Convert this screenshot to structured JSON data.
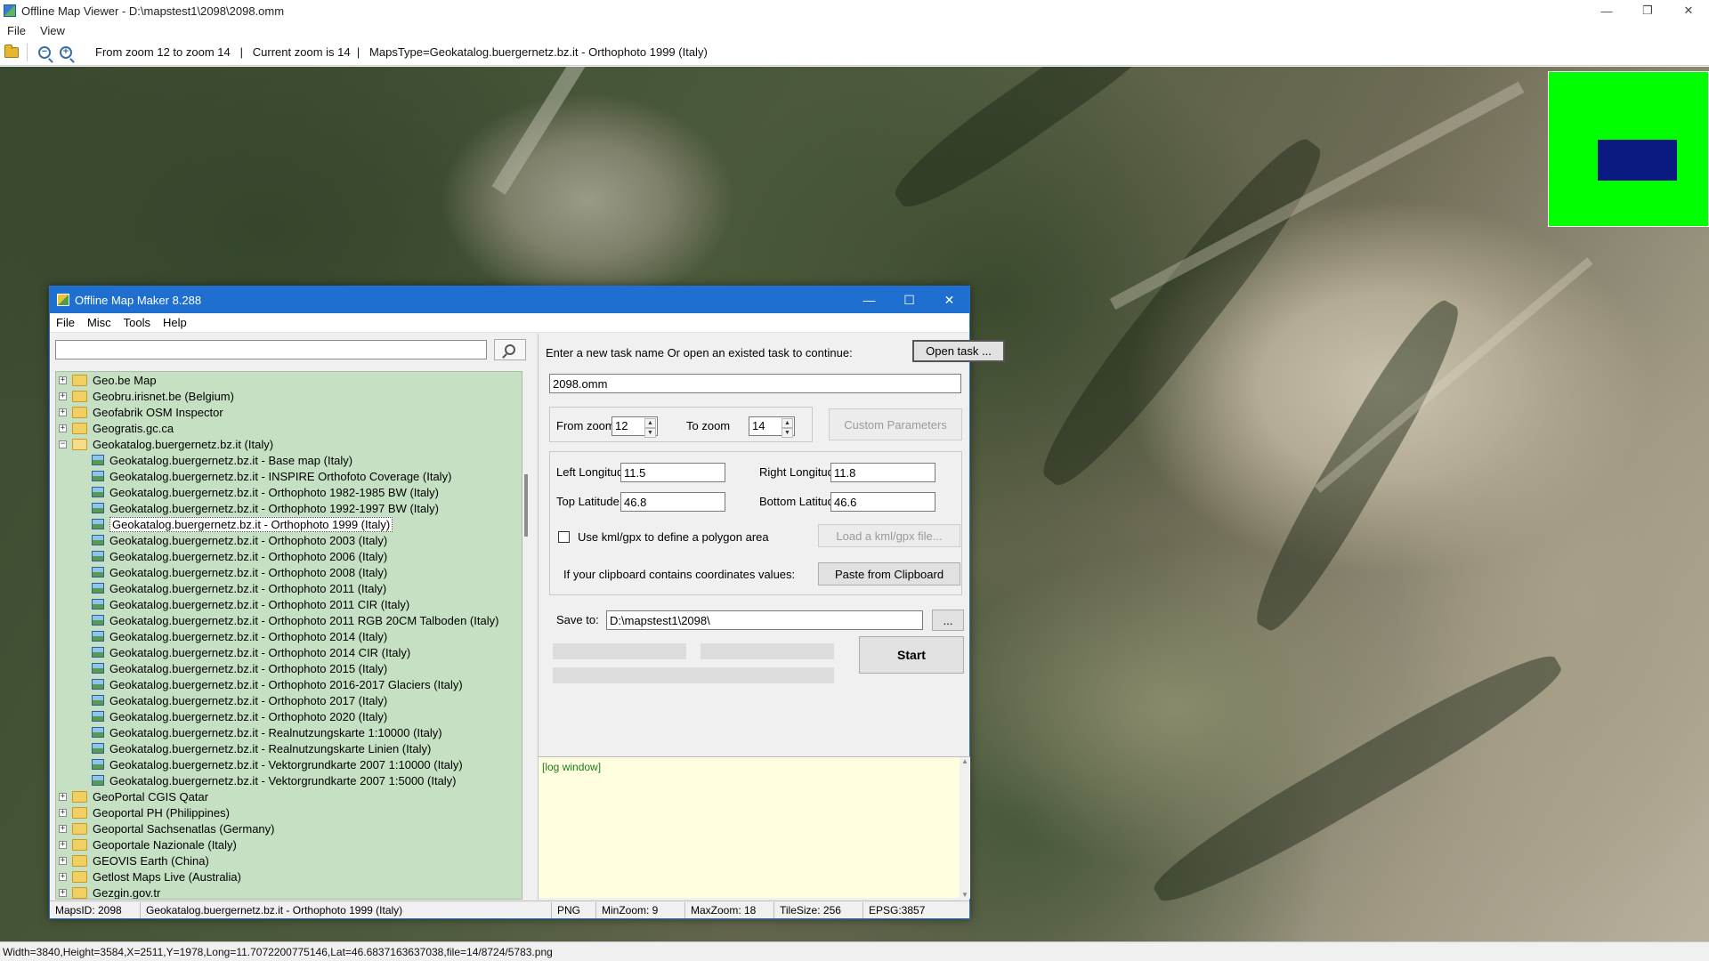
{
  "window": {
    "title": "Offline Map Viewer - D:\\mapstest1\\2098\\2098.omm",
    "controls": {
      "minimize": "—",
      "maximize": "❐",
      "close": "✕"
    }
  },
  "menubar": {
    "file": "File",
    "view": "View"
  },
  "toolbar": {
    "info": "From zoom 12 to zoom 14   |   Current zoom is 14  |   MapsType=Geokatalog.buergernetz.bz.it - Orthophoto 1999 (Italy)",
    "zoom_out_glyph": "−",
    "zoom_in_glyph": "+"
  },
  "statusbar": {
    "text": "Width=3840,Height=3584,X=2511,Y=1978,Long=11.7072200775146,Lat=46.6837163637038,file=14/8724/5783.png"
  },
  "minimap": {
    "background": "#00ff00",
    "view_color": "#0a1a80"
  },
  "dialog": {
    "title": "Offline Map Maker 8.288",
    "controls": {
      "minimize": "—",
      "maximize": "☐",
      "close": "✕"
    },
    "menu": {
      "file": "File",
      "misc": "Misc",
      "tools": "Tools",
      "help": "Help"
    },
    "search": {
      "value": "",
      "placeholder": ""
    },
    "tree": {
      "before": [
        "Geo.be Map",
        "Geobru.irisnet.be (Belgium)",
        "Geofabrik OSM Inspector",
        "Geogratis.gc.ca"
      ],
      "expanded": {
        "label": "Geokatalog.buergernetz.bz.it (Italy)",
        "children": [
          "Geokatalog.buergernetz.bz.it - Base map (Italy)",
          "Geokatalog.buergernetz.bz.it - INSPIRE Orthofoto Coverage (Italy)",
          "Geokatalog.buergernetz.bz.it - Orthophoto 1982-1985 BW (Italy)",
          "Geokatalog.buergernetz.bz.it - Orthophoto 1992-1997 BW (Italy)",
          "Geokatalog.buergernetz.bz.it - Orthophoto 1999 (Italy)",
          "Geokatalog.buergernetz.bz.it - Orthophoto 2003 (Italy)",
          "Geokatalog.buergernetz.bz.it - Orthophoto 2006 (Italy)",
          "Geokatalog.buergernetz.bz.it - Orthophoto 2008 (Italy)",
          "Geokatalog.buergernetz.bz.it - Orthophoto 2011 (Italy)",
          "Geokatalog.buergernetz.bz.it - Orthophoto 2011 CIR (Italy)",
          "Geokatalog.buergernetz.bz.it - Orthophoto 2011 RGB 20CM Talboden (Italy)",
          "Geokatalog.buergernetz.bz.it - Orthophoto 2014 (Italy)",
          "Geokatalog.buergernetz.bz.it - Orthophoto 2014 CIR (Italy)",
          "Geokatalog.buergernetz.bz.it - Orthophoto 2015 (Italy)",
          "Geokatalog.buergernetz.bz.it - Orthophoto 2016-2017 Glaciers (Italy)",
          "Geokatalog.buergernetz.bz.it - Orthophoto 2017 (Italy)",
          "Geokatalog.buergernetz.bz.it - Orthophoto 2020 (Italy)",
          "Geokatalog.buergernetz.bz.it - Realnutzungskarte 1:10000 (Italy)",
          "Geokatalog.buergernetz.bz.it - Realnutzungskarte Linien (Italy)",
          "Geokatalog.buergernetz.bz.it - Vektorgrundkarte 2007 1:10000 (Italy)",
          "Geokatalog.buergernetz.bz.it - Vektorgrundkarte 2007 1:5000 (Italy)"
        ],
        "selected_index": 4
      },
      "after": [
        "GeoPortal CGIS Qatar",
        "Geoportal PH (Philippines)",
        "Geoportal Sachsenatlas (Germany)",
        "Geoportale Nazionale (Italy)",
        "GEOVIS Earth (China)",
        "Getlost Maps Live (Australia)",
        "Gezgin.gov.tr"
      ],
      "expand_glyph": "+",
      "collapse_glyph": "−"
    },
    "task": {
      "prompt": "Enter a new task name Or open an existed task to continue:",
      "open_button": "Open task ...",
      "name_value": "2098.omm"
    },
    "zoom": {
      "from_label": "From zoom",
      "from_value": "12",
      "to_label": "To zoom",
      "to_value": "14",
      "custom_button": "Custom Parameters",
      "up_glyph": "▲",
      "down_glyph": "▼"
    },
    "coords": {
      "left_lon_label": "Left Longitude",
      "left_lon_value": "11.5",
      "right_lon_label": "Right Longitude",
      "right_lon_value": "11.8",
      "top_lat_label": "Top Latitude",
      "top_lat_value": "46.8",
      "bottom_lat_label": "Bottom Latitude",
      "bottom_lat_value": "46.6",
      "kml_checkbox_label": "Use kml/gpx to define a polygon area",
      "kml_checked": false,
      "load_kml_button": "Load a kml/gpx file...",
      "clipboard_label": "If your clipboard contains coordinates values:",
      "paste_button": "Paste from Clipboard"
    },
    "save": {
      "label": "Save to:",
      "value": "D:\\mapstest1\\2098\\",
      "browse_button": "..."
    },
    "start_button": "Start",
    "log": {
      "text": "[log window]",
      "scroll_up": "▲",
      "scroll_down": "▼"
    },
    "status": {
      "maps_id": "MapsID: 2098",
      "maps_name": "Geokatalog.buergernetz.bz.it - Orthophoto 1999 (Italy)",
      "format": "PNG",
      "min_zoom": "MinZoom: 9",
      "max_zoom": "MaxZoom: 18",
      "tile_size": "TileSize: 256",
      "epsg": "EPSG:3857"
    }
  }
}
